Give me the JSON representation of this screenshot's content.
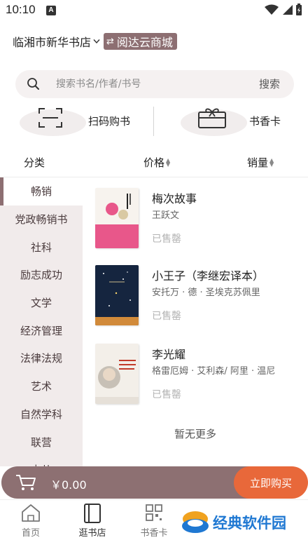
{
  "status_bar": {
    "time": "10:10",
    "notif_letter": "A"
  },
  "store": {
    "name": "临湘市新华书店",
    "switch_label": "阅达云商城"
  },
  "search": {
    "placeholder": "搜索书名/作者/书号",
    "value": "",
    "button": "搜索"
  },
  "quick_actions": [
    {
      "label": "扫码购书",
      "icon": "scan-icon"
    },
    {
      "label": "书香卡",
      "icon": "gift-card-icon"
    }
  ],
  "sort": {
    "category": "分类",
    "price": "价格",
    "sales": "销量"
  },
  "categories": [
    "畅销",
    "党政畅销书",
    "社科",
    "励志成功",
    "文学",
    "经济管理",
    "法律法规",
    "艺术",
    "自然学科",
    "联营",
    "少儿"
  ],
  "active_category": "畅销",
  "books": [
    {
      "title": "梅次故事",
      "author": "王跃文",
      "status": "已售罄"
    },
    {
      "title": "小王子（李继宏译本）",
      "author": "安托万 · 德 · 圣埃克苏佩里",
      "status": "已售罄"
    },
    {
      "title": "李光耀",
      "author": "格雷厄姆 · 艾利森/ 阿里 · 温尼",
      "status": "已售罄"
    }
  ],
  "list_end": "暂无更多",
  "cart": {
    "total": "￥0.00",
    "buy_label": "立即购买"
  },
  "tabs": [
    {
      "label": "首页",
      "icon": "home-icon"
    },
    {
      "label": "逛书店",
      "icon": "book-icon"
    },
    {
      "label": "书香卡",
      "icon": "qr-icon"
    }
  ],
  "watermark": "经典软件园",
  "colors": {
    "accent": "#8d6f72",
    "buy": "#e8683a",
    "sidebar_bg": "#f1ebeb"
  }
}
